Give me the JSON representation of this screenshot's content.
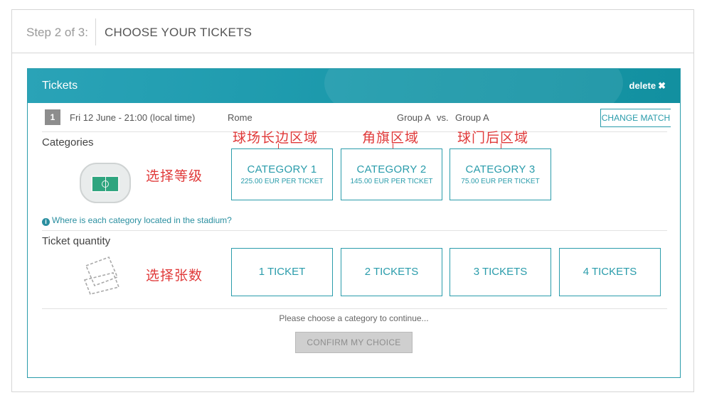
{
  "step": {
    "label": "Step 2 of 3:",
    "title": "CHOOSE YOUR TICKETS"
  },
  "panel": {
    "title": "Tickets",
    "delete_label": "delete",
    "delete_icon": "close-icon"
  },
  "match": {
    "number": "1",
    "datetime": "Fri 12 June - 21:00 (local time)",
    "city": "Rome",
    "team_a": "Group A",
    "vs": "vs.",
    "team_b": "Group A",
    "change_label": "CHANGE MATCH"
  },
  "categories": {
    "label": "Categories",
    "annotation": "选择等级",
    "items": [
      {
        "name": "CATEGORY 1",
        "price": "225.00 EUR PER TICKET",
        "annotation": "球场长边区域"
      },
      {
        "name": "CATEGORY 2",
        "price": "145.00 EUR PER TICKET",
        "annotation": "角旗区域"
      },
      {
        "name": "CATEGORY 3",
        "price": "75.00 EUR PER TICKET",
        "annotation": "球门后区域"
      }
    ],
    "info_text": "Where is each category located in the stadium?"
  },
  "quantity": {
    "label": "Ticket quantity",
    "annotation": "选择张数",
    "options": [
      "1 TICKET",
      "2 TICKETS",
      "3 TICKETS",
      "4 TICKETS"
    ]
  },
  "footer": {
    "message": "Please choose a category to continue...",
    "confirm_label": "CONFIRM MY CHOICE"
  },
  "colors": {
    "accent": "#2a9cab",
    "annotation": "#e03a3a",
    "header_bg": "#1a98aa"
  }
}
